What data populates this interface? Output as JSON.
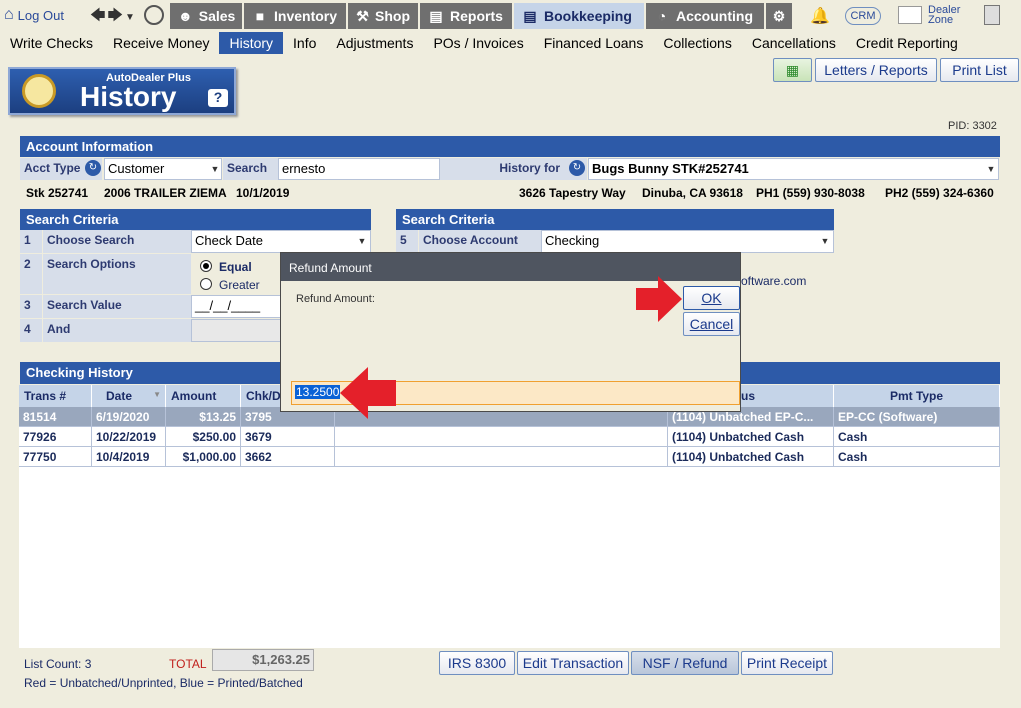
{
  "topnav": {
    "logout": "Log Out",
    "tabs": [
      {
        "label": "Sales",
        "icon": "salesman-icon"
      },
      {
        "label": "Inventory",
        "icon": "car-icon"
      },
      {
        "label": "Shop",
        "icon": "wrench-icon"
      },
      {
        "label": "Reports",
        "icon": "report-icon"
      },
      {
        "label": "Bookkeeping",
        "icon": "book-icon"
      },
      {
        "label": "Accounting",
        "icon": "pie-chart-icon"
      }
    ],
    "crm": "CRM",
    "dealer_zone_line1": "Dealer",
    "dealer_zone_line2": "Zone"
  },
  "menu": [
    "Write Checks",
    "Receive Money",
    "History",
    "Info",
    "Adjustments",
    "POs / Invoices",
    "Financed Loans",
    "Collections",
    "Cancellations",
    "Credit Reporting"
  ],
  "header": {
    "brand": "AutoDealer Plus",
    "title": "History",
    "help": "?",
    "letters_reports": "Letters / Reports",
    "print_list": "Print List",
    "pid": "PID: 3302"
  },
  "account": {
    "title": "Account Information",
    "acct_type_label": "Acct Type",
    "acct_type_value": "Customer",
    "search_label": "Search",
    "search_value": "ernesto",
    "history_for_label": "History for",
    "history_for_value": "Bugs Bunny  STK#252741",
    "stk": "Stk 252741",
    "vehicle": "2006 TRAILER ZIEMA",
    "date": "10/1/2019",
    "address": "3626 Tapestry Way",
    "city": "Dinuba, CA 93618",
    "ph1": "PH1 (559) 930-8038",
    "ph2": "PH2 (559) 324-6360"
  },
  "criteria_left": {
    "title": "Search Criteria",
    "rows": [
      {
        "num": "1",
        "label": "Choose Search",
        "value": "Check Date"
      },
      {
        "num": "2",
        "label": "Search Options",
        "opt1": "Equal",
        "opt2": "Greater"
      },
      {
        "num": "3",
        "label": "Search Value",
        "value": "__/__/____"
      },
      {
        "num": "4",
        "label": "And",
        "value": ""
      }
    ]
  },
  "criteria_right": {
    "title": "Search Criteria",
    "num": "5",
    "label": "Choose Account",
    "value": "Checking",
    "partial_text": "oftware.com"
  },
  "history": {
    "title": "Checking History",
    "columns": [
      "Trans #",
      "Date",
      "Amount",
      "Chk/D",
      "tus",
      "Pmt Type"
    ],
    "rows": [
      {
        "trans": "81514",
        "date": "6/19/2020",
        "amount": "$13.25",
        "chk": "3795",
        "status": "(1104) Unbatched EP-C...",
        "pmt": "EP-CC (Software)"
      },
      {
        "trans": "77926",
        "date": "10/22/2019",
        "amount": "$250.00",
        "chk": "3679",
        "status": "(1104) Unbatched Cash",
        "pmt": "Cash"
      },
      {
        "trans": "77750",
        "date": "10/4/2019",
        "amount": "$1,000.00",
        "chk": "3662",
        "status": "(1104) Unbatched Cash",
        "pmt": "Cash"
      }
    ]
  },
  "footer": {
    "list_count": "List Count: 3",
    "total_label": "TOTAL",
    "total_value": "$1,263.25",
    "legend": "Red = Unbatched/Unprinted, Blue = Printed/Batched",
    "buttons": [
      "IRS 8300",
      "Edit Transaction",
      "NSF / Refund",
      "Print Receipt"
    ]
  },
  "dialog": {
    "title": "Refund Amount",
    "label": "Refund Amount:",
    "ok": "OK",
    "cancel": "Cancel",
    "value": "13.2500"
  },
  "colors": {
    "accent": "#2d5aa8",
    "arrow": "#e4202a"
  }
}
